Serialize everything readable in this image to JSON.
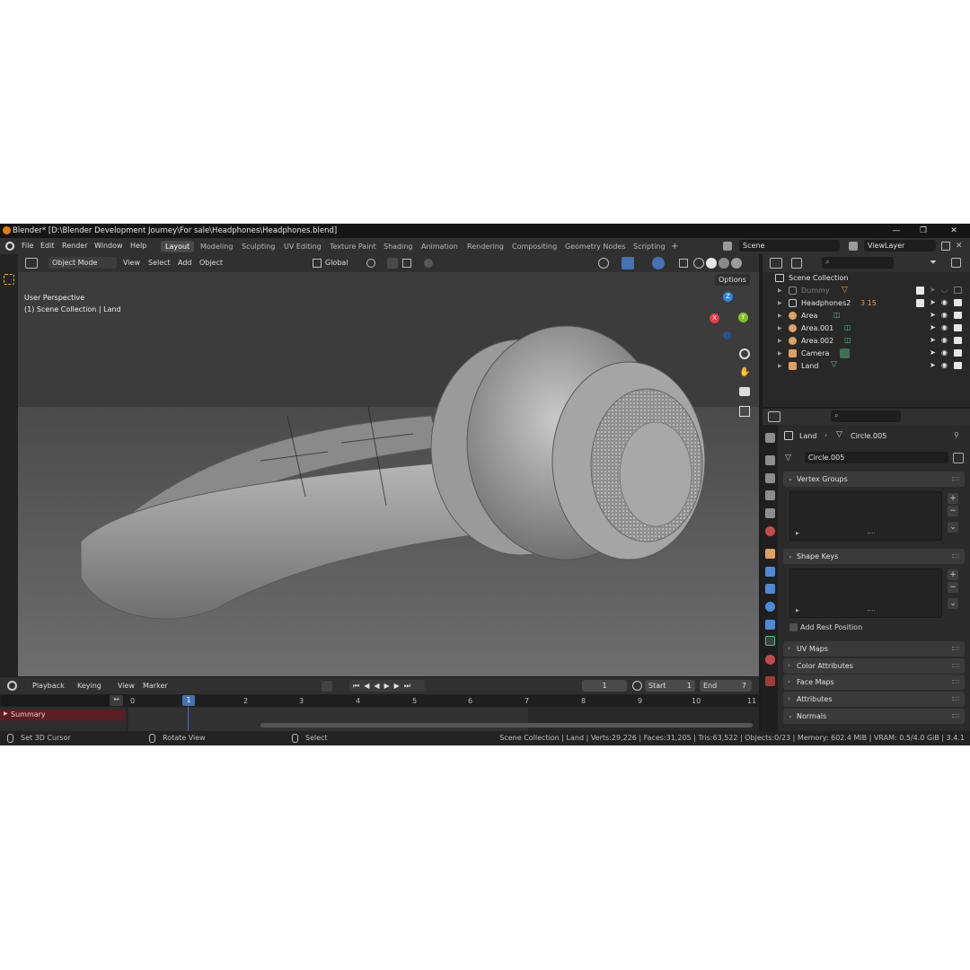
{
  "window": {
    "title": "Blender* [D:\\Blender Development Journey\\For sale\\Headphones\\Headphones.blend]",
    "minimize": "—",
    "maximize": "❐",
    "close": "✕"
  },
  "menu": [
    "File",
    "Edit",
    "Render",
    "Window",
    "Help"
  ],
  "workspaces": [
    "Layout",
    "Modeling",
    "Sculpting",
    "UV Editing",
    "Texture Paint",
    "Shading",
    "Animation",
    "Rendering",
    "Compositing",
    "Geometry Nodes",
    "Scripting",
    "+"
  ],
  "active_workspace": "Layout",
  "scene": {
    "name": "Scene",
    "view_layer": "ViewLayer"
  },
  "viewport_header": {
    "mode": "Object Mode",
    "menus": [
      "View",
      "Select",
      "Add",
      "Object"
    ],
    "transform_orientation": "Global",
    "options": "Options"
  },
  "viewport": {
    "perspective": "User Perspective",
    "collection_info": "(1) Scene Collection | Land",
    "gizmo": {
      "x": "X",
      "y": "Y",
      "z": "Z"
    }
  },
  "timeline": {
    "menus": [
      "Playback",
      "Keying",
      "View",
      "Marker"
    ],
    "current_frame": "1",
    "start_label": "Start",
    "start": "1",
    "end_label": "End",
    "end": "7",
    "ruler": [
      "0",
      "1",
      "2",
      "3",
      "4",
      "5",
      "6",
      "7",
      "8",
      "9",
      "10",
      "11"
    ],
    "summary": "Summary"
  },
  "status_bar": {
    "left_action": "Set 3D Cursor",
    "middle_action": "Rotate View",
    "right_action": "Select",
    "stats": "Scene Collection | Land | Verts:29,226 | Faces:31,205 | Tris:63,522 | Objects:0/23 | Memory: 602.4 MiB | VRAM: 0.5/4.0 GiB | 3.4.1"
  },
  "outliner": {
    "root": "Scene Collection",
    "items": [
      {
        "name": "Dummy",
        "icon": "collection-icon",
        "color": "#8a8a8a",
        "dim": true
      },
      {
        "name": "Headphones2",
        "icon": "collection-icon",
        "color": "#cfcfcf",
        "badges": "3 15"
      },
      {
        "name": "Area",
        "icon": "light-icon",
        "color": "#e0a060"
      },
      {
        "name": "Area.001",
        "icon": "light-icon",
        "color": "#e0a060"
      },
      {
        "name": "Area.002",
        "icon": "light-icon",
        "color": "#e0a060"
      },
      {
        "name": "Camera",
        "icon": "camera-icon",
        "color": "#e0a060"
      },
      {
        "name": "Land",
        "icon": "mesh-icon",
        "color": "#e0a060"
      }
    ]
  },
  "properties": {
    "object": "Land",
    "mesh": "Circle.005",
    "data_name": "Circle.005",
    "panels": {
      "vertex_groups": "Vertex Groups",
      "shape_keys": "Shape Keys",
      "add_rest_position": "Add Rest Position",
      "uv_maps": "UV Maps",
      "color_attributes": "Color Attributes",
      "face_maps": "Face Maps",
      "attributes": "Attributes",
      "normals": "Normals"
    }
  },
  "colors": {
    "accent": "#4772b3",
    "blender_orange": "#e87d0d",
    "axis_x": "#e33d4a",
    "axis_y": "#7ec51e",
    "axis_z": "#2e86de",
    "summary_bg": "#5e1d24"
  }
}
